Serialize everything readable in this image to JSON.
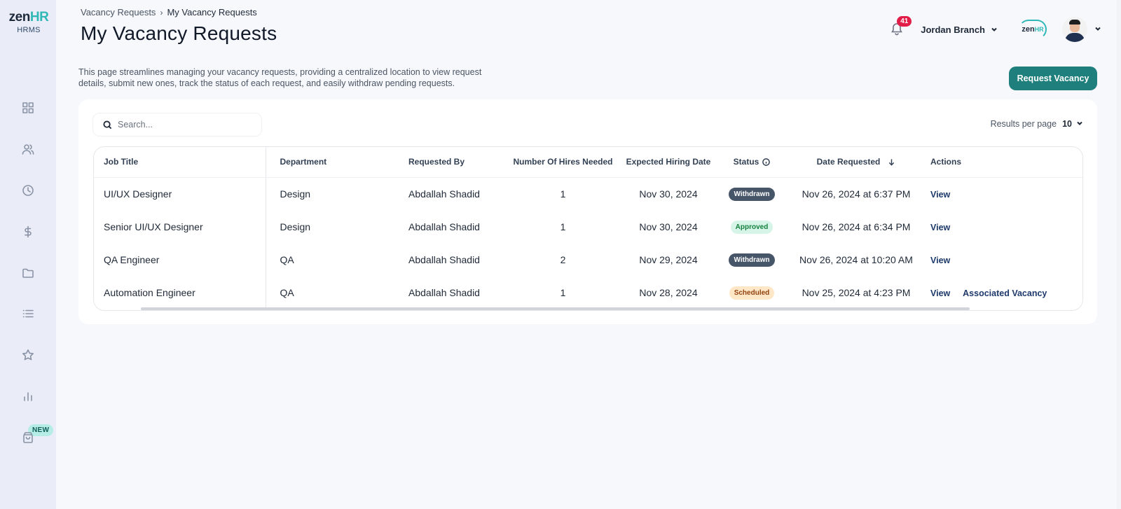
{
  "brand": {
    "logo_main": "zen",
    "logo_accent": "HR",
    "logo_sub": "HRMS",
    "new_badge": "NEW",
    "accent_color": "#2fb8b6",
    "primary_color": "#1f7f7d"
  },
  "sidebar": {
    "items": [
      {
        "name": "dashboard-icon"
      },
      {
        "name": "people-icon"
      },
      {
        "name": "clock-icon"
      },
      {
        "name": "dollar-icon"
      },
      {
        "name": "folder-icon"
      },
      {
        "name": "list-icon"
      },
      {
        "name": "star-icon"
      },
      {
        "name": "bar-chart-icon"
      },
      {
        "name": "bag-icon"
      }
    ]
  },
  "breadcrumb": {
    "parent": "Vacancy Requests",
    "separator": "›",
    "current": "My Vacancy Requests"
  },
  "page": {
    "title": "My Vacancy Requests",
    "description": "This page streamlines managing your vacancy requests, providing a centralized location to view request details, submit new ones, track the status of each request, and easily withdraw pending requests.",
    "cta_label": "Request Vacancy"
  },
  "header": {
    "notification_count": "41",
    "user_name": "Jordan Branch",
    "mini_logo_main": "zen",
    "mini_logo_accent": "HR"
  },
  "search": {
    "placeholder": "Search..."
  },
  "pagination": {
    "label": "Results per page",
    "value": "10"
  },
  "table": {
    "columns": {
      "job_title": "Job Title",
      "department": "Department",
      "requested_by": "Requested By",
      "hires": "Number Of Hires Needed",
      "expected_date": "Expected Hiring Date",
      "status": "Status",
      "date_requested": "Date Requested",
      "actions": "Actions"
    },
    "rows": [
      {
        "job_title": "UI/UX Designer",
        "department": "Design",
        "requested_by": "Abdallah Shadid",
        "hires": "1",
        "expected_date": "Nov 30, 2024",
        "status": "Withdrawn",
        "date_requested": "Nov 26, 2024 at 6:37 PM",
        "action_view": "View",
        "action_extra": ""
      },
      {
        "job_title": "Senior UI/UX Designer",
        "department": "Design",
        "requested_by": "Abdallah Shadid",
        "hires": "1",
        "expected_date": "Nov 30, 2024",
        "status": "Approved",
        "date_requested": "Nov 26, 2024 at 6:34 PM",
        "action_view": "View",
        "action_extra": ""
      },
      {
        "job_title": "QA Engineer",
        "department": "QA",
        "requested_by": "Abdallah Shadid",
        "hires": "2",
        "expected_date": "Nov 29, 2024",
        "status": "Withdrawn",
        "date_requested": "Nov 26, 2024 at 10:20 AM",
        "action_view": "View",
        "action_extra": ""
      },
      {
        "job_title": "Automation Engineer",
        "department": "QA",
        "requested_by": "Abdallah Shadid",
        "hires": "1",
        "expected_date": "Nov 28, 2024",
        "status": "Scheduled",
        "date_requested": "Nov 25, 2024 at 4:23 PM",
        "action_view": "View",
        "action_extra": "Associated Vacancy"
      }
    ]
  }
}
